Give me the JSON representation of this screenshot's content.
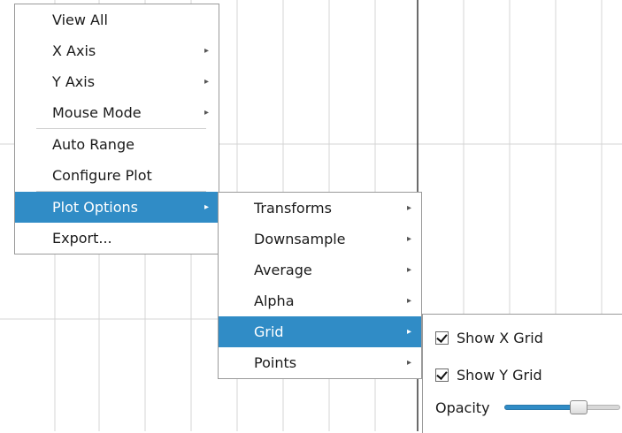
{
  "main_menu": {
    "items": [
      {
        "label": "View All"
      },
      {
        "label": "X Axis",
        "submenu": true
      },
      {
        "label": "Y Axis",
        "submenu": true
      },
      {
        "label": "Mouse Mode",
        "submenu": true
      },
      {
        "label": "Auto Range"
      },
      {
        "label": "Configure Plot"
      },
      {
        "label": "Plot Options",
        "submenu": true,
        "highlighted": true
      },
      {
        "label": "Export..."
      }
    ]
  },
  "plot_options_menu": {
    "items": [
      {
        "label": "Transforms",
        "submenu": true
      },
      {
        "label": "Downsample",
        "submenu": true
      },
      {
        "label": "Average",
        "submenu": true
      },
      {
        "label": "Alpha",
        "submenu": true
      },
      {
        "label": "Grid",
        "submenu": true,
        "highlighted": true
      },
      {
        "label": "Points",
        "submenu": true
      }
    ]
  },
  "grid_menu": {
    "show_x_grid": {
      "label": "Show X Grid",
      "checked": true
    },
    "show_y_grid": {
      "label": "Show Y Grid",
      "checked": true
    },
    "opacity": {
      "label": "Opacity",
      "value": 0.67
    }
  },
  "colors": {
    "highlight": "#308cc6",
    "grid_line": "#d4d4d4",
    "axis_line": "#3a3a3a"
  },
  "icons": {
    "submenu_arrow": "▸"
  }
}
